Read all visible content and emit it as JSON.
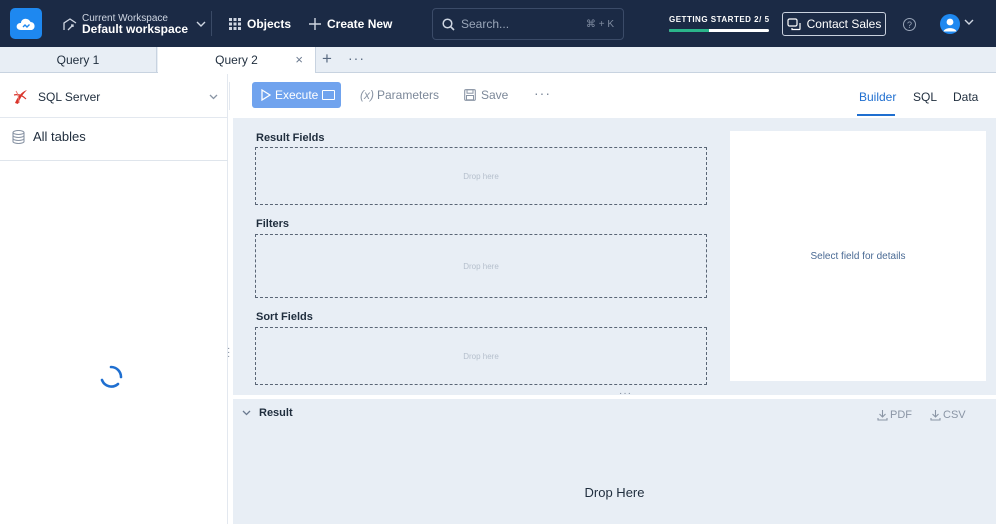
{
  "topbar": {
    "workspace_caption": "Current Workspace",
    "workspace_name": "Default workspace",
    "objects_label": "Objects",
    "create_new_label": "Create New",
    "search_placeholder": "Search...",
    "search_shortcut": "⌘ + K",
    "getting_started_label": "GETTING STARTED 2/ 5",
    "getting_started_progress": 0.4,
    "contact_sales_label": "Contact Sales",
    "help_glyph": "?",
    "colors": {
      "bar_bg": "#1b2a45",
      "logo": "#1e88f0",
      "progress": "#2bb58a"
    }
  },
  "tabs": [
    {
      "label": "Query 1",
      "active": false
    },
    {
      "label": "Query 2",
      "active": true
    }
  ],
  "tab_actions": {
    "close_glyph": "×",
    "add_glyph": "+",
    "more_glyph": "···"
  },
  "left_panel": {
    "datasource": "SQL Server",
    "all_tables_label": "All tables"
  },
  "toolbar": {
    "execute_label": "Execute",
    "parameters_prefix": "(x)",
    "parameters_label": "Parameters",
    "save_label": "Save",
    "more_glyph": "···",
    "view_tabs": [
      {
        "label": "Builder",
        "active": true
      },
      {
        "label": "SQL",
        "active": false
      },
      {
        "label": "Data",
        "active": false
      }
    ]
  },
  "builder": {
    "result_fields_label": "Result Fields",
    "filters_label": "Filters",
    "sort_fields_label": "Sort Fields",
    "drop_placeholder": "Drop here",
    "details_placeholder": "Select field for details"
  },
  "result": {
    "title": "Result",
    "pdf_label": "PDF",
    "csv_label": "CSV",
    "drop_label": "Drop Here"
  }
}
